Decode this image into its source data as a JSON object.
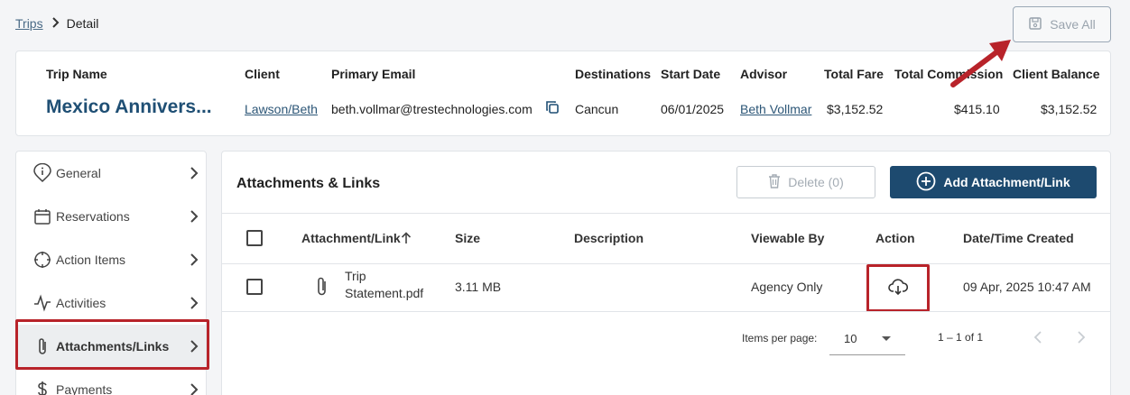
{
  "breadcrumb": {
    "parent": "Trips",
    "separator": "›",
    "current": "Detail"
  },
  "toolbar": {
    "save_all_label": "Save All"
  },
  "header": {
    "trip_name_label": "Trip Name",
    "trip_name": "Mexico Annivers...",
    "client_label": "Client",
    "client": "Lawson/Beth",
    "email_label": "Primary Email",
    "email": "beth.vollmar@trestechnologies.com",
    "destinations_label": "Destinations",
    "destinations": "Cancun",
    "start_date_label": "Start Date",
    "start_date": "06/01/2025",
    "advisor_label": "Advisor",
    "advisor": "Beth Vollmar",
    "total_fare_label": "Total Fare",
    "total_fare": "$3,152.52",
    "total_commission_label": "Total Commission",
    "total_commission": "$415.10",
    "client_balance_label": "Client Balance",
    "client_balance": "$3,152.52"
  },
  "sidebar": {
    "items": [
      {
        "label": "General",
        "icon": "info-pin-icon"
      },
      {
        "label": "Reservations",
        "icon": "calendar-icon"
      },
      {
        "label": "Action Items",
        "icon": "target-icon"
      },
      {
        "label": "Activities",
        "icon": "activity-icon"
      },
      {
        "label": "Attachments/Links",
        "icon": "paperclip-icon",
        "active": true
      },
      {
        "label": "Payments",
        "icon": "dollar-icon"
      }
    ]
  },
  "main": {
    "title": "Attachments & Links",
    "delete_label": "Delete (0)",
    "add_label": "Add Attachment/Link",
    "columns": {
      "attachment": "Attachment/Link",
      "size": "Size",
      "description": "Description",
      "viewable_by": "Viewable By",
      "action": "Action",
      "date_created": "Date/Time Created"
    },
    "rows": [
      {
        "name_line1": "Trip",
        "name_line2": "Statement.pdf",
        "size": "3.11 MB",
        "description": "",
        "viewable_by": "Agency Only",
        "action_icon": "cloud-download-icon",
        "date_created": "09 Apr, 2025 10:47 AM"
      }
    ],
    "pager": {
      "items_per_page_label": "Items per page:",
      "items_per_page": "10",
      "range": "1 – 1 of 1"
    }
  },
  "colors": {
    "primary": "#1d4a6f",
    "highlight": "#b8232a",
    "link": "#2c5677"
  }
}
